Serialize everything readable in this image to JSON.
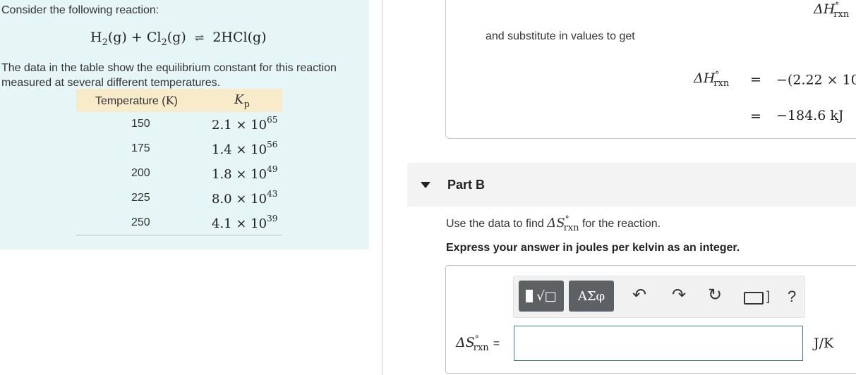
{
  "left": {
    "intro": "Consider the following reaction:",
    "equation": "H2(g) + Cl2(g) ⇌ 2HCl(g)",
    "description": "The data in the table show the equilibrium constant for this reaction measured at several different temperatures.",
    "table": {
      "headers": [
        "Temperature (K)",
        "Kp"
      ],
      "rows": [
        {
          "temp": "150",
          "kp_mantissa": "2.1 × 10",
          "kp_exp": "65"
        },
        {
          "temp": "175",
          "kp_mantissa": "1.4 × 10",
          "kp_exp": "56"
        },
        {
          "temp": "200",
          "kp_mantissa": "1.8 × 10",
          "kp_exp": "49"
        },
        {
          "temp": "225",
          "kp_mantissa": "8.0 × 10",
          "kp_exp": "43"
        },
        {
          "temp": "250",
          "kp_mantissa": "4.1 × 10",
          "kp_exp": "39"
        }
      ]
    }
  },
  "solution": {
    "top_symbol": "ΔH°rxn",
    "substitute_text": "and substitute in values to get",
    "symbol": "ΔH°rxn",
    "equals": "=",
    "line1_value": "−(2.22 × 10",
    "line2_value": "−184.6 kJ"
  },
  "partB": {
    "title": "Part B",
    "question_pre": "Use the data to find",
    "question_symbol": "ΔS°rxn",
    "question_post": "for the reaction.",
    "instruction": "Express your answer in joules per kelvin as an integer.",
    "toolbar": {
      "templates_label": "√□",
      "greek_label": "ΑΣφ",
      "undo_icon": "undo-icon",
      "redo_icon": "redo-icon",
      "reset_icon": "reset-icon",
      "keyboard_icon": "keyboard-icon",
      "help_label": "?"
    },
    "answer_label": "ΔS°rxn =",
    "answer_value": "",
    "unit": "J/K"
  },
  "colors": {
    "left_panel_bg": "#e6f5f5",
    "table_header_bg": "#f8ebc9",
    "toolbar_button": "#5e6164",
    "input_border": "#3c7e8c"
  }
}
